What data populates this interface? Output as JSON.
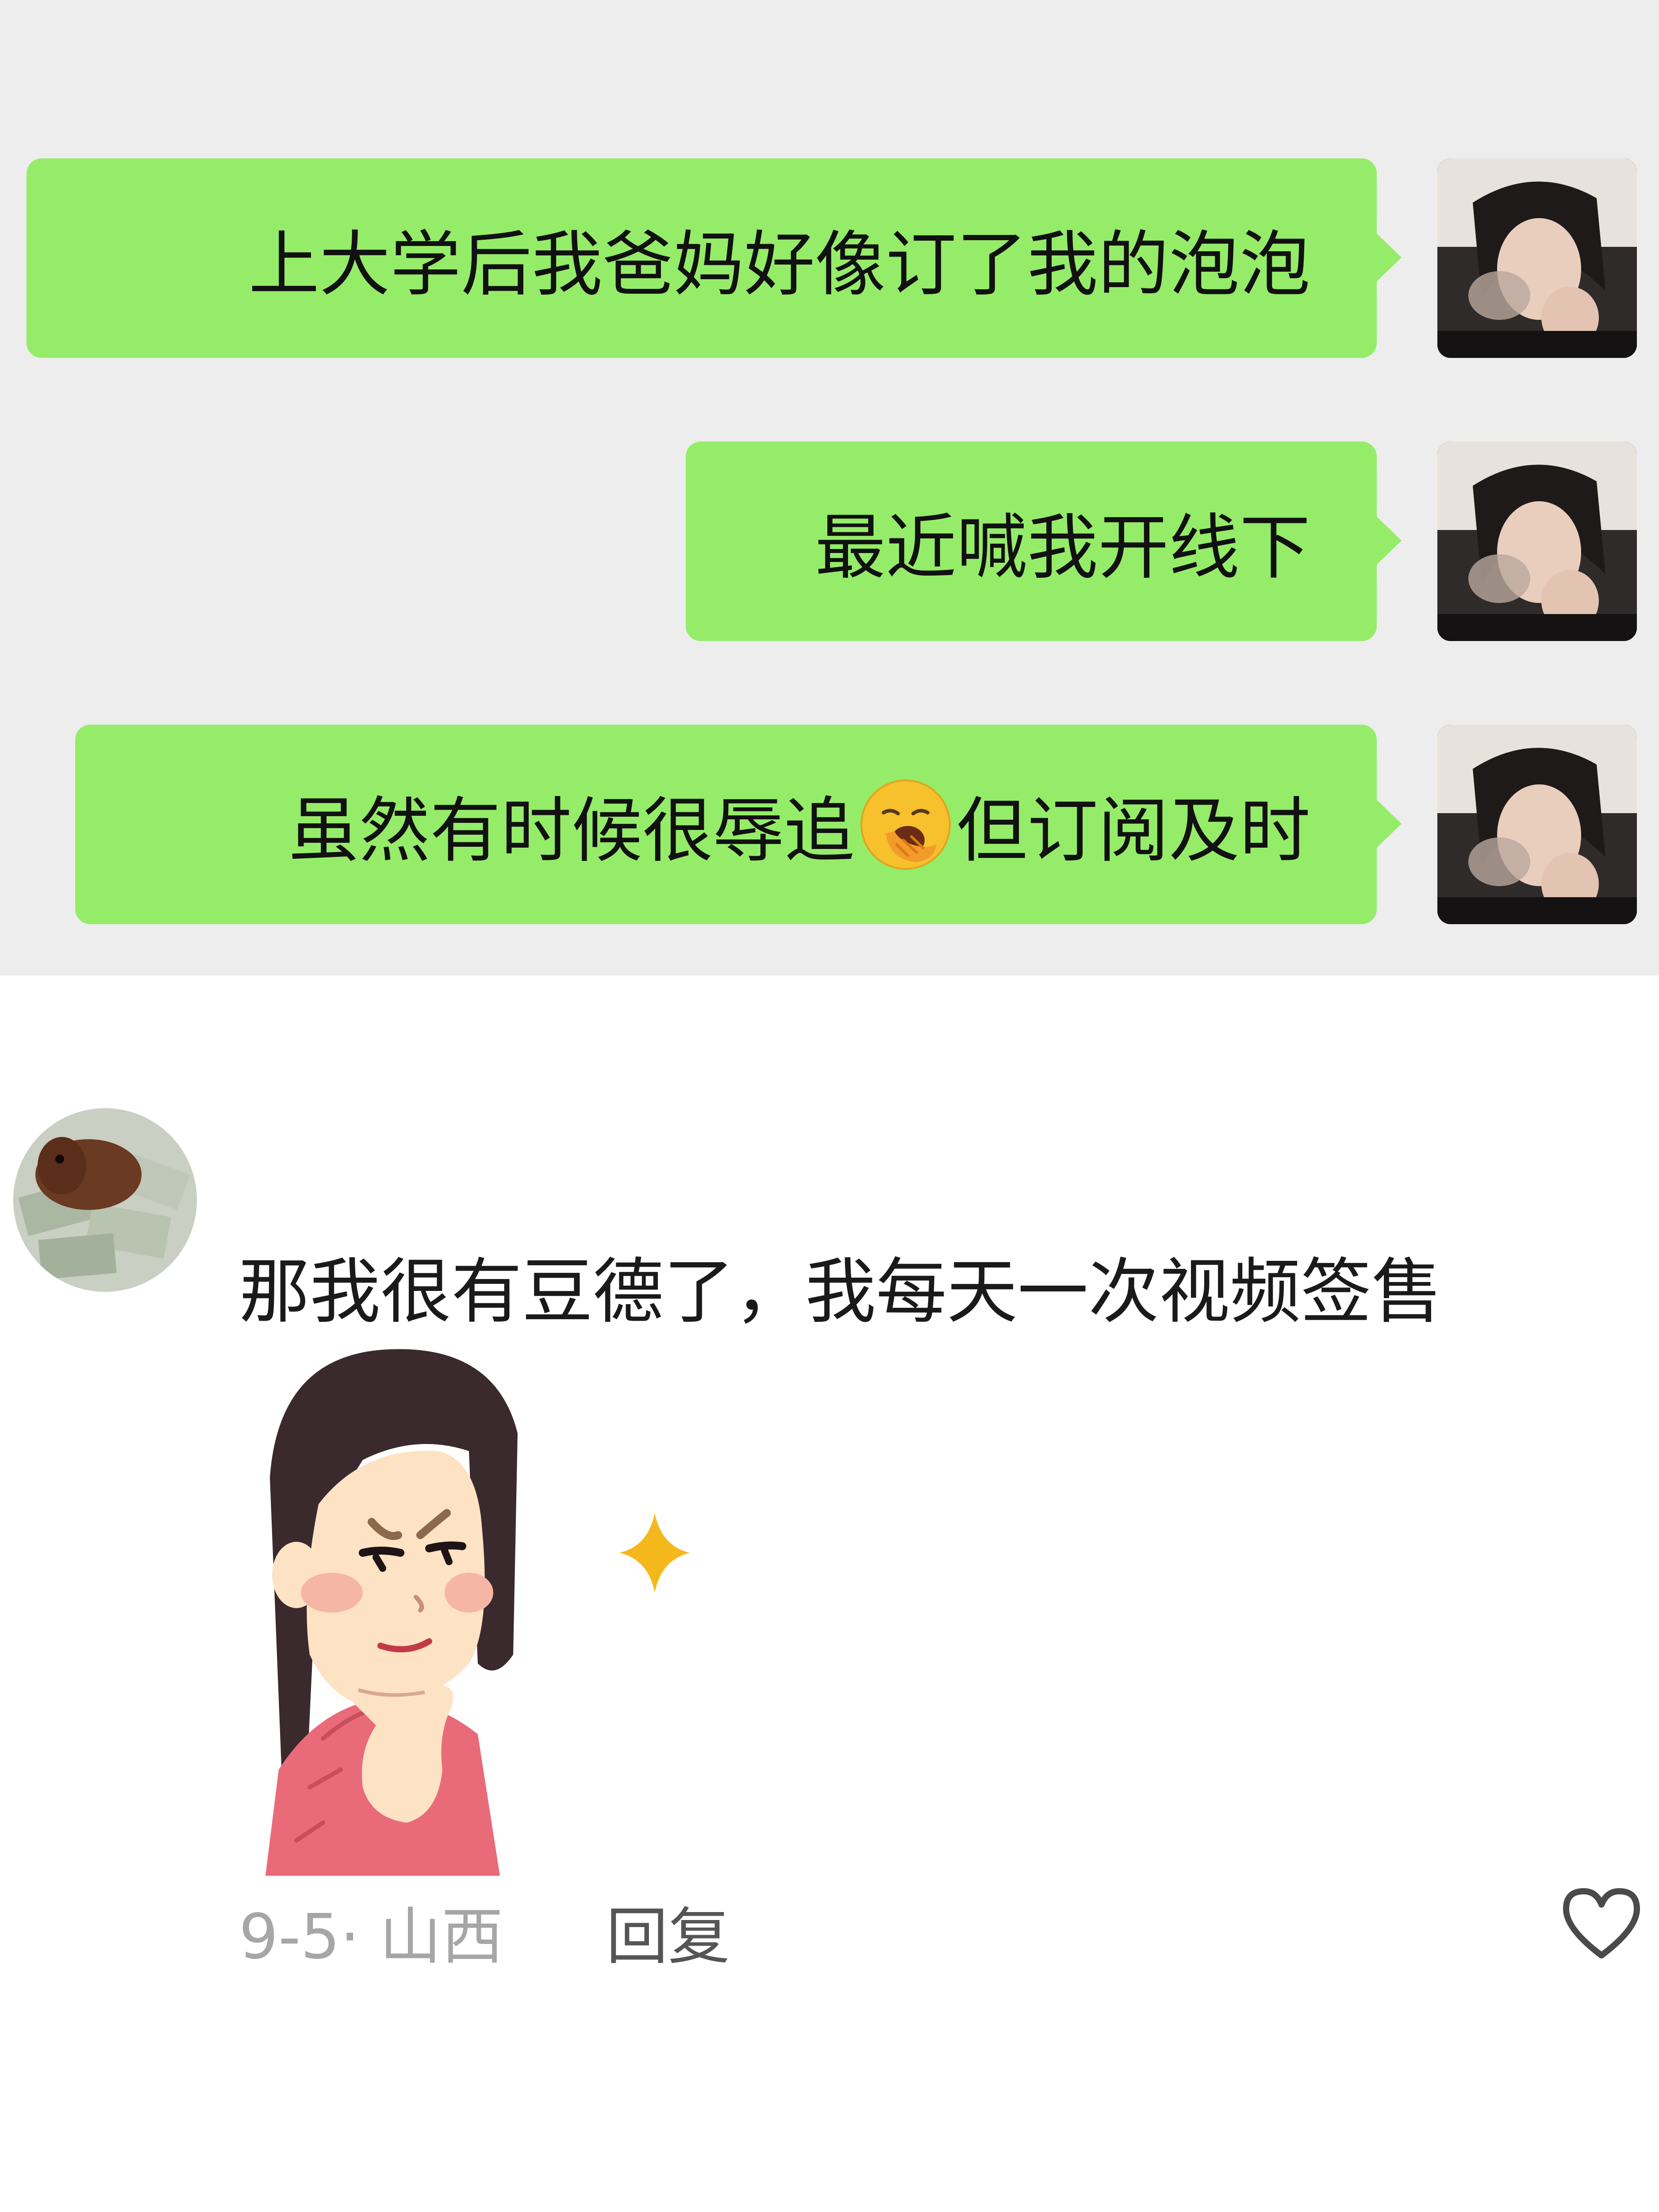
{
  "chat": {
    "messages": [
      {
        "text": "上大学后我爸妈好像订了我的泡泡"
      },
      {
        "text": "最近喊我开线下"
      },
      {
        "text_before": "虽然有时候很辱追",
        "emoji": "yawning-face-icon",
        "text_after": "但订阅及时"
      }
    ],
    "bubble_color": "#95ec69",
    "background_color": "#ededed"
  },
  "comment": {
    "text": "那我很有豆德了，我每天一次视频签售",
    "date_location": "9-5· 山西",
    "reply_label": "回复",
    "like_icon": "heart-outline-icon"
  }
}
